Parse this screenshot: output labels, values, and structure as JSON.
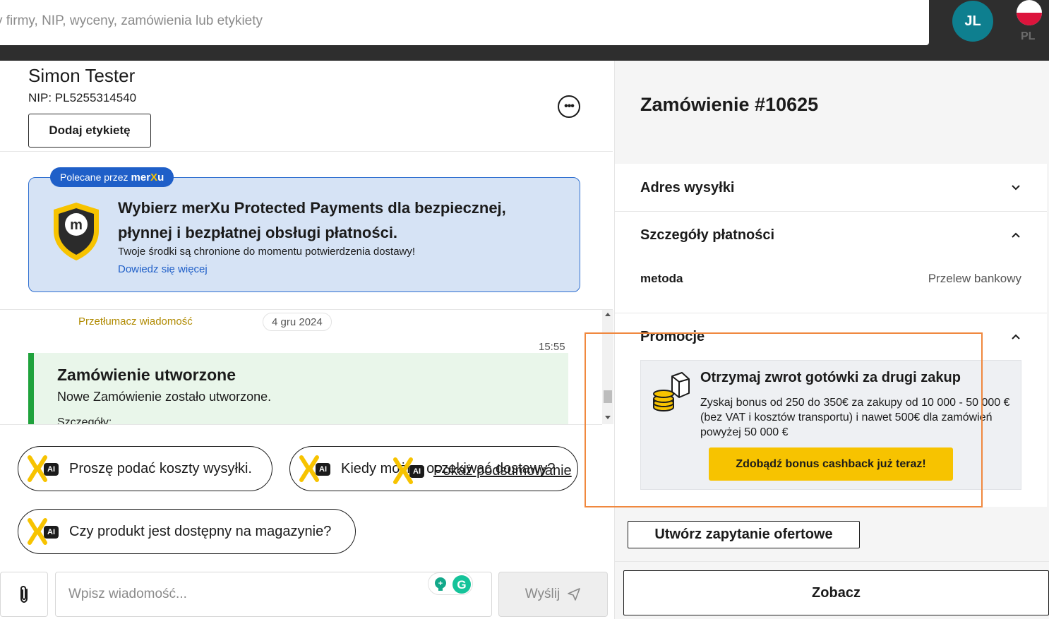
{
  "topbar": {
    "search_placeholder": "y firmy, NIP, wyceny, zamówienia lub etykiety",
    "avatar_initials": "JL",
    "language_code": "PL"
  },
  "company": {
    "name": "Simon Tester",
    "nip": "NIP: PL5255314540",
    "add_label_button": "Dodaj etykietę",
    "more_button": "•••"
  },
  "promo": {
    "tag_prefix": "Polecane przez",
    "tag_brand_a": "mer",
    "tag_brand_x": "X",
    "tag_brand_b": "u",
    "title": "Wybierz merXu Protected Payments dla bezpiecznej, płynnej i bezpłatnej obsługi płatności.",
    "subtitle": "Twoje środki są chronione do momentu potwierdzenia dostawy!",
    "link": "Dowiedz się więcej"
  },
  "chat": {
    "translate_link": "Przetłumacz wiadomość",
    "date_chip": "4 gru 2024",
    "time": "15:55",
    "message": {
      "title": "Zamówienie utworzone",
      "body": "Nowe Zamówienie zostało utworzone.",
      "cut_text": "Szczegóły:"
    }
  },
  "suggestions": {
    "ai_label": "AI",
    "items": [
      "Proszę podać koszty wysyłki.",
      "Kiedy można oczekiwać dostawy?",
      "Czy produkt jest dostępny na magazynie?"
    ],
    "summary_link": "Pokaż podsumowanie"
  },
  "composer": {
    "placeholder": "Wpisz wiadomość...",
    "send_label": "Wyślij"
  },
  "order": {
    "title": "Zamówienie #10625",
    "sections": {
      "shipping": "Adres wysyłki",
      "payment": "Szczegóły płatności",
      "promotions": "Promocje"
    },
    "payment_method_key": "metoda",
    "payment_method_value": "Przelew bankowy",
    "cashback": {
      "title": "Otrzymaj zwrot gotówki za drugi zakup",
      "text": "Zyskaj bonus od 250 do 350€ za zakupy od 10 000 - 50 000 € (bez VAT i kosztów transportu) i nawet 500€ dla zamówień powyżej 50 000 €",
      "button": "Zdobądź bonus cashback już teraz!"
    },
    "rfq_button": "Utwórz zapytanie ofertowe",
    "see_button": "Zobacz"
  },
  "colors": {
    "accent_yellow": "#f7c300",
    "brand_blue": "#1f5fc8",
    "success_green": "#1fa23c",
    "avatar_teal": "#0e7f8f",
    "highlight_orange": "#f0883e"
  }
}
